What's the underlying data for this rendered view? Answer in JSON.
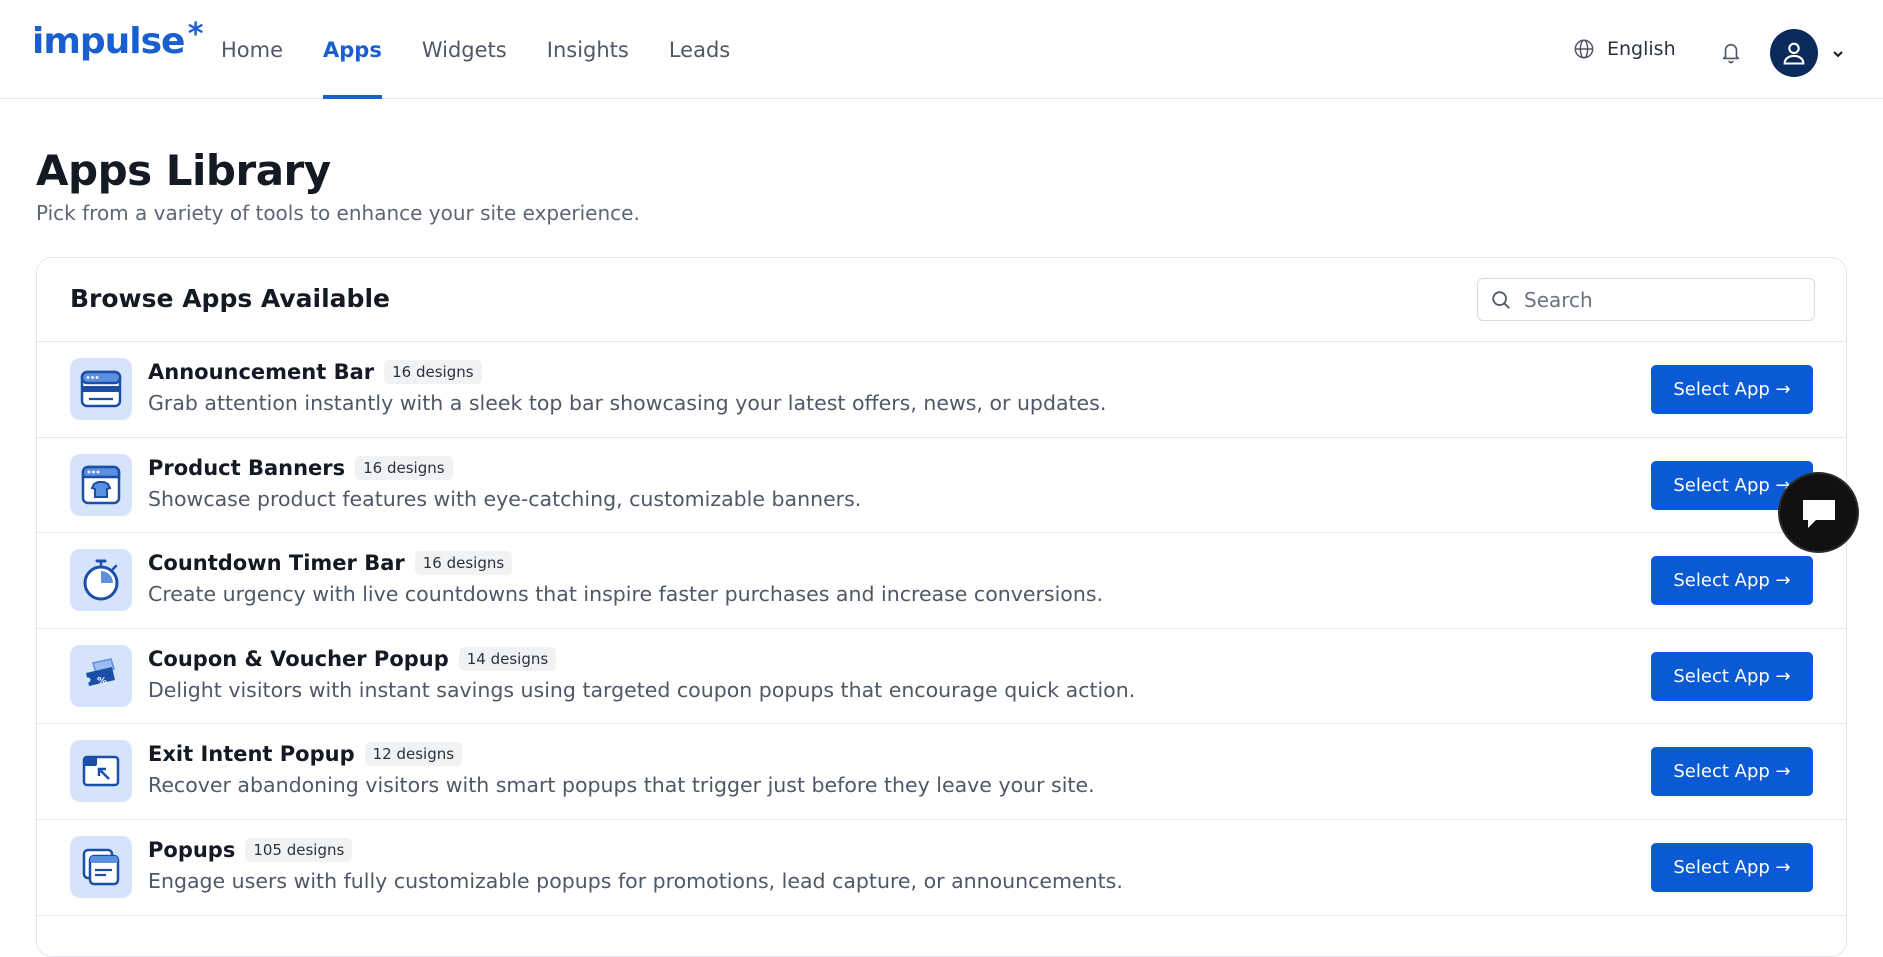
{
  "brand": {
    "logo_text": "impulse",
    "logo_star": "*",
    "color": "#1a5fd0"
  },
  "nav": {
    "items": [
      {
        "label": "Home",
        "active": false
      },
      {
        "label": "Apps",
        "active": true
      },
      {
        "label": "Widgets",
        "active": false
      },
      {
        "label": "Insights",
        "active": false
      },
      {
        "label": "Leads",
        "active": false
      }
    ]
  },
  "header": {
    "language": "English",
    "icons": [
      "globe-icon",
      "bell-icon",
      "user-icon",
      "chevron-down-icon"
    ]
  },
  "page": {
    "title": "Apps Library",
    "subtitle": "Pick from a variety of tools to enhance your site experience."
  },
  "browse": {
    "title": "Browse Apps Available",
    "search_placeholder": "Search",
    "search_value": ""
  },
  "apps": [
    {
      "name": "Announcement Bar",
      "designs": "16 designs",
      "description": "Grab attention instantly with a sleek top bar showcasing your latest offers, news, or updates.",
      "button": "Select App →",
      "icon": "announcement-bar-icon"
    },
    {
      "name": "Product Banners",
      "designs": "16 designs",
      "description": "Showcase product features with eye-catching, customizable banners.",
      "button": "Select App →",
      "icon": "product-banner-icon"
    },
    {
      "name": "Countdown Timer Bar",
      "designs": "16 designs",
      "description": "Create urgency with live countdowns that inspire faster purchases and increase conversions.",
      "button": "Select App →",
      "icon": "stopwatch-icon"
    },
    {
      "name": "Coupon & Voucher Popup",
      "designs": "14 designs",
      "description": "Delight visitors with instant savings using targeted coupon popups that encourage quick action.",
      "button": "Select App →",
      "icon": "coupon-icon"
    },
    {
      "name": "Exit Intent Popup",
      "designs": "12 designs",
      "description": "Recover abandoning visitors with smart popups that trigger just before they leave your site.",
      "button": "Select App →",
      "icon": "exit-intent-icon"
    },
    {
      "name": "Popups",
      "designs": "105 designs",
      "description": "Engage users with fully customizable popups for promotions, lead capture, or announcements.",
      "button": "Select App →",
      "icon": "popups-icon"
    }
  ],
  "colors": {
    "primary_button": "#0a5ad6",
    "icon_bg": "#d6e4fb",
    "avatar_bg": "#0b2a5c"
  }
}
